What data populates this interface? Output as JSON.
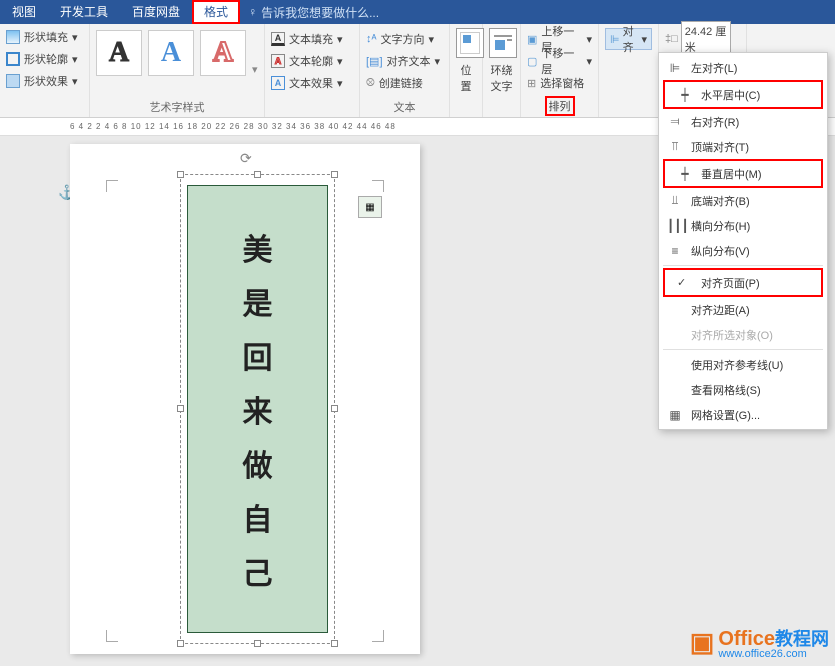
{
  "tabs": [
    "视图",
    "开发工具",
    "百度网盘",
    "格式"
  ],
  "active_tab": "格式",
  "tellme": "告诉我您想要做什么...",
  "ribbon": {
    "shape": {
      "fill": "形状填充",
      "outline": "形状轮廓",
      "effects": "形状效果"
    },
    "wordart": {
      "label": "艺术字样式",
      "glyph": "A"
    },
    "textfmt": {
      "fill": "文本填充",
      "outline": "文本轮廓",
      "effects": "文本效果"
    },
    "text": {
      "dir": "文字方向",
      "align": "对齐文本",
      "link": "创建链接",
      "label": "文本"
    },
    "position": "位置",
    "wrap": "环绕文字",
    "arrange": {
      "up": "上移一层",
      "down": "下移一层",
      "pane": "选择窗格",
      "label": "排列"
    },
    "align_btn": "对齐",
    "size_val": "24.42 厘米"
  },
  "ruler": "6 4 2    2 4 6 8 10 12 14 16 18 20 22   26 28 30 32 34 36 38 40 42 44 46 48",
  "shape_text": [
    "美",
    "是",
    "回",
    "来",
    "做",
    "自",
    "己"
  ],
  "dropdown": {
    "left": "左对齐(L)",
    "hcenter": "水平居中(C)",
    "right": "右对齐(R)",
    "top": "顶端对齐(T)",
    "vcenter": "垂直居中(M)",
    "bottom": "底端对齐(B)",
    "hdist": "横向分布(H)",
    "vdist": "纵向分布(V)",
    "page": "对齐页面(P)",
    "margin": "对齐边距(A)",
    "sel": "对齐所选对象(O)",
    "guides": "使用对齐参考线(U)",
    "grid": "查看网格线(S)",
    "gridset": "网格设置(G)..."
  },
  "watermark": {
    "brand": "Office",
    "sub": "教程网",
    "url": "www.office26.com"
  }
}
